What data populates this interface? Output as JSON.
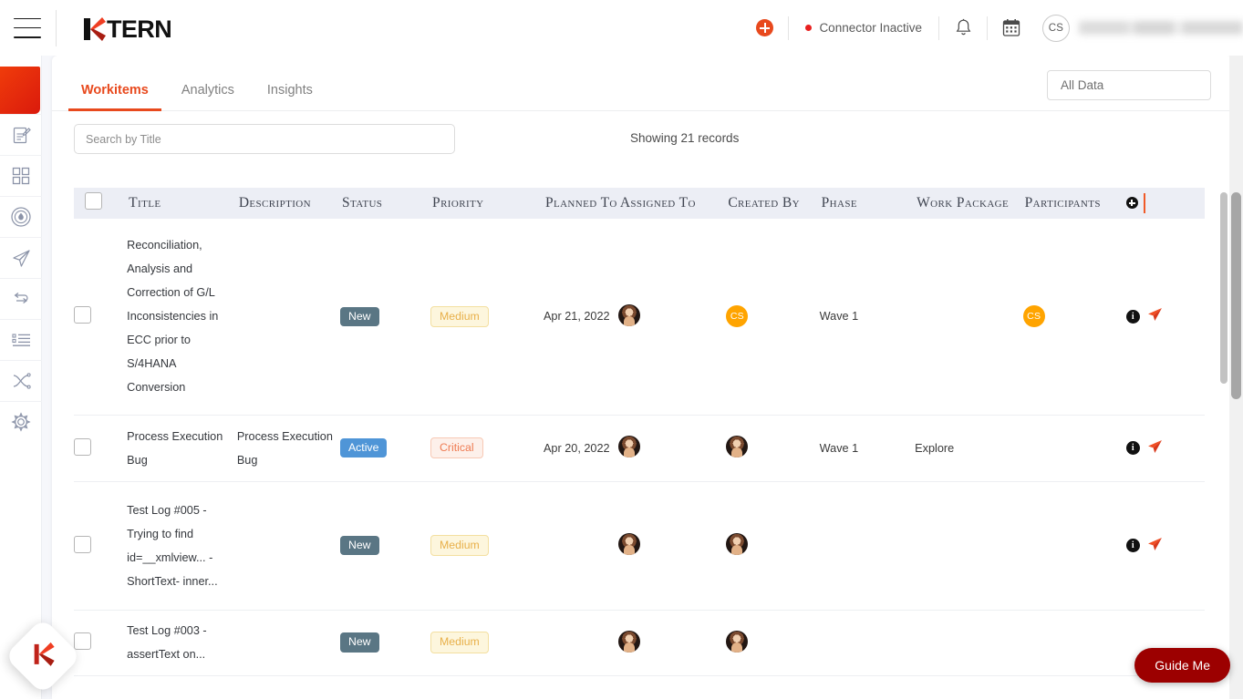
{
  "topbar": {
    "menu_icon": "hamburger-icon",
    "brand": "TERN",
    "brand_mark": "K",
    "add_icon": "plus-circle-icon",
    "connector_status": "Connector Inactive",
    "connector_dot_color": "#e8201f",
    "notifications_icon": "bell-icon",
    "calendar_icon": "calendar-icon",
    "avatar_initials": "CS",
    "username": ""
  },
  "sidebar": {
    "items": [
      {
        "name": "app-tile",
        "icon": "red-tile"
      },
      {
        "name": "notes",
        "icon": "document-edit-icon"
      },
      {
        "name": "dashboard",
        "icon": "grid-squares-icon"
      },
      {
        "name": "digital-map",
        "icon": "flame-circle-icon"
      },
      {
        "name": "deploy",
        "icon": "paper-plane-icon"
      },
      {
        "name": "sync",
        "icon": "process-flow-icon"
      },
      {
        "name": "workitems",
        "icon": "list-icon"
      },
      {
        "name": "shuffle",
        "icon": "shuffle-icon"
      },
      {
        "name": "settings",
        "icon": "gear-icon"
      }
    ]
  },
  "tabs": [
    {
      "label": "Workitems",
      "active": true
    },
    {
      "label": "Analytics",
      "active": false
    },
    {
      "label": "Insights",
      "active": false
    }
  ],
  "filter": {
    "selected": "All Data"
  },
  "search": {
    "placeholder": "Search by Title",
    "value": ""
  },
  "records_label": "Showing 21 records",
  "colors": {
    "accent": "#e8491d",
    "badge_new": "#5a7684",
    "badge_active": "#4f95d7",
    "badge_medium_text": "#e8b04a",
    "badge_critical_text": "#ef7b52",
    "avatar_cs": "#ffa400",
    "guide_me": "#9c0000"
  },
  "table": {
    "columns": [
      "Title",
      "Description",
      "Status",
      "Priority",
      "Planned To",
      "Assigned To",
      "Created By",
      "Phase",
      "Work Package",
      "Participants"
    ],
    "add_column_icon": "plus-circle-black-icon",
    "rows": [
      {
        "title": "Reconciliation, Analysis and Correction of G/L Inconsistencies in ECC prior to S/4HANA Conversion",
        "description": "",
        "status": "New",
        "status_kind": "new",
        "priority": "Medium",
        "priority_kind": "medium",
        "planned_to": "Apr 21, 2022",
        "assigned_to": "photo",
        "created_by": "CS",
        "phase": "Wave 1",
        "work_package": "",
        "participants": "CS",
        "actions": [
          "info-icon",
          "send-icon"
        ]
      },
      {
        "title": "Process Execution Bug",
        "description": "Process Execution Bug",
        "status": "Active",
        "status_kind": "active",
        "priority": "Critical",
        "priority_kind": "critical",
        "planned_to": "Apr 20, 2022",
        "assigned_to": "photo",
        "created_by": "photo",
        "phase": "Wave 1",
        "work_package": "Explore",
        "participants": "",
        "actions": [
          "info-icon",
          "send-icon"
        ]
      },
      {
        "title": "Test Log #005 - Trying to find id=__xmlview... -ShortText- inner...",
        "description": "",
        "status": "New",
        "status_kind": "new",
        "priority": "Medium",
        "priority_kind": "medium",
        "planned_to": "",
        "assigned_to": "photo",
        "created_by": "photo",
        "phase": "",
        "work_package": "",
        "participants": "",
        "actions": [
          "info-icon",
          "send-icon"
        ]
      },
      {
        "title": "Test Log #003 - assertText on...",
        "description": "",
        "status": "New",
        "status_kind": "new",
        "priority": "Medium",
        "priority_kind": "medium",
        "planned_to": "",
        "assigned_to": "photo",
        "created_by": "photo",
        "phase": "",
        "work_package": "",
        "participants": "",
        "actions": []
      }
    ]
  },
  "fab": {
    "label": "K",
    "name": "ktern-assistant-fab"
  },
  "guide_me": {
    "label": "Guide Me"
  }
}
